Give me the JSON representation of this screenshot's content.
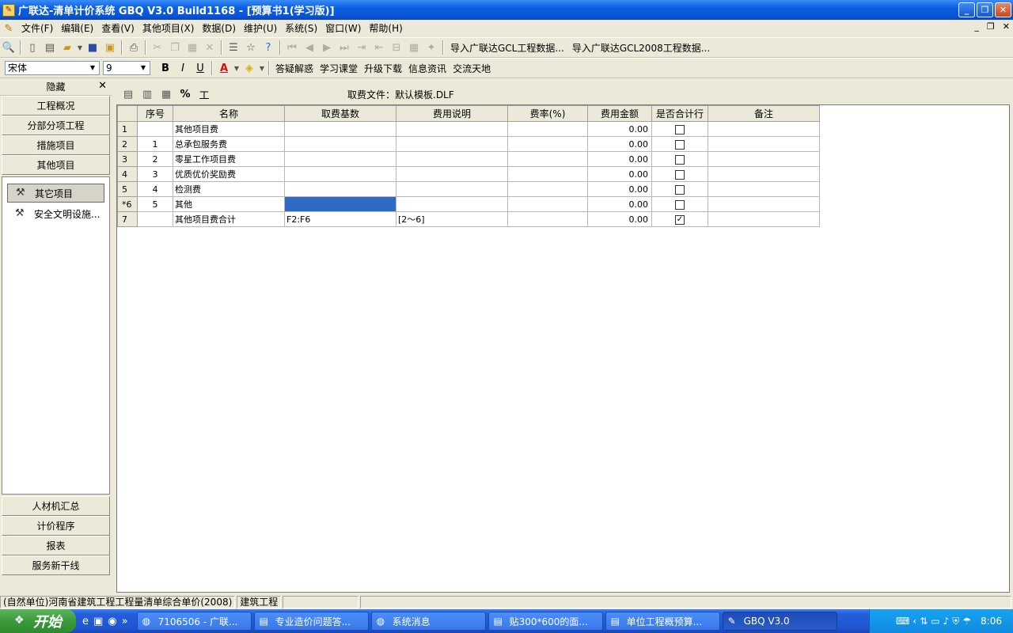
{
  "window": {
    "title": "广联达-清单计价系统 GBQ V3.0 Build1168 - [预算书1(学习版)]",
    "min": "_",
    "max": "❐",
    "close": "✕"
  },
  "menu": [
    "文件(F)",
    "编辑(E)",
    "查看(V)",
    "其他项目(X)",
    "数据(D)",
    "维护(U)",
    "系统(S)",
    "窗口(W)",
    "帮助(H)"
  ],
  "mdi_controls": [
    "_",
    "❐",
    "✕"
  ],
  "toolbar1": {
    "import_gcl": "导入广联达GCL工程数据...",
    "import_gcl2008": "导入广联达GCL2008工程数据..."
  },
  "toolbar2": {
    "font_name": "宋体",
    "font_size": "9",
    "bold": "B",
    "italic": "I",
    "underline": "U",
    "font_color": "A",
    "links": [
      "答疑解惑",
      "学习课堂",
      "升级下载",
      "信息资讯",
      "交流天地"
    ]
  },
  "left_panel": {
    "hide_label": "隐藏",
    "close": "✕",
    "top_nav": [
      "工程概况",
      "分部分项工程",
      "措施项目",
      "其他项目"
    ],
    "list_items": [
      {
        "label": "其它项目",
        "selected": true
      },
      {
        "label": "安全文明设施...",
        "selected": false
      }
    ],
    "bottom_nav": [
      "人材机汇总",
      "计价程序",
      "报表",
      "服务新干线"
    ]
  },
  "grid_toolbar": {
    "pct": "%",
    "gong": "工",
    "fee_file": "取费文件：默认模板.DLF"
  },
  "table": {
    "headers": [
      "",
      "序号",
      "名称",
      "取费基数",
      "费用说明",
      "费率(%)",
      "费用金额",
      "是否合计行",
      "备注"
    ],
    "rows": [
      {
        "row": "1",
        "seq": "",
        "name": "其他项目费",
        "base": "",
        "desc": "",
        "rate": "",
        "amount": "0.00",
        "total_row": false,
        "note": ""
      },
      {
        "row": "2",
        "seq": "1",
        "name": "总承包服务费",
        "base": "",
        "desc": "",
        "rate": "",
        "amount": "0.00",
        "total_row": false,
        "note": ""
      },
      {
        "row": "3",
        "seq": "2",
        "name": "零星工作项目费",
        "base": "",
        "desc": "",
        "rate": "",
        "amount": "0.00",
        "total_row": false,
        "note": ""
      },
      {
        "row": "4",
        "seq": "3",
        "name": "优质优价奖励费",
        "base": "",
        "desc": "",
        "rate": "",
        "amount": "0.00",
        "total_row": false,
        "note": ""
      },
      {
        "row": "5",
        "seq": "4",
        "name": "检测费",
        "base": "",
        "desc": "",
        "rate": "",
        "amount": "0.00",
        "total_row": false,
        "note": ""
      },
      {
        "row": "*6",
        "seq": "5",
        "name": "其他",
        "base": "",
        "desc": "",
        "rate": "",
        "amount": "0.00",
        "total_row": false,
        "note": ""
      },
      {
        "row": "7",
        "seq": "",
        "name": "其他项目费合计",
        "base": "F2:F6",
        "desc": "[2～6]",
        "rate": "",
        "amount": "0.00",
        "total_row": true,
        "note": ""
      }
    ]
  },
  "status": {
    "unit": "(自然单位)河南省建筑工程工程量清单综合单价(2008)",
    "type": "建筑工程"
  },
  "taskbar": {
    "start": "开始",
    "more": "»",
    "tasks": [
      {
        "label": "7106506 - 广联..."
      },
      {
        "label": "专业造价问题答..."
      },
      {
        "label": "系统消息"
      },
      {
        "label": "贴300*600的面..."
      },
      {
        "label": "单位工程概预算..."
      },
      {
        "label": "GBQ V3.0",
        "active": true
      }
    ],
    "time": "8:06"
  }
}
